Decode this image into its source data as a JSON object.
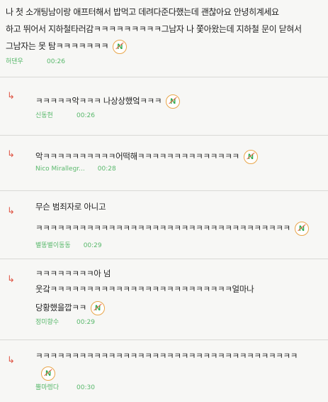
{
  "post": {
    "text_lines": [
      "나 첫 소개팅남이랑 애프터해서 밥먹고 데려다준다했는데 괜찮아요 안녕히계세요",
      "하고 뛰어서 지하철타러감ㅋㅋㅋㅋㅋㅋㅋㅋㅋ그남자 나 쫓아왔는데 지하철 문이 닫혀서",
      "그남자는 못 탐ㅋㅋㅋㅋㅋㅋㅋ"
    ],
    "author": "허댄우",
    "time": "00:26"
  },
  "badge_letter": "N",
  "replies": [
    {
      "lines": [
        "ㅋㅋㅋㅋㅋ악ㅋㅋㅋ 나상상했엌ㅋㅋㅋ"
      ],
      "author": "신동현",
      "time": "00:26"
    },
    {
      "lines": [
        "악ㅋㅋㅋㅋㅋㅋㅋㅋㅋㅋ어떡해ㅋㅋㅋㅋㅋㅋㅋㅋㅋㅋㅋㅋㅋㅋ"
      ],
      "author": "Nico Mirallegr...",
      "time": "00:28"
    },
    {
      "lines": [
        "무슨 범죄자로 아니고",
        "ㅋㅋㅋㅋㅋㅋㅋㅋㅋㅋㅋㅋㅋㅋㅋㅋㅋㅋㅋㅋㅋㅋㅋㅋㅋㅋㅋㅋㅋㅋㅋㅋㅋㅋㅋ"
      ],
      "author": "별똥별이동동",
      "time": "00:29"
    },
    {
      "lines": [
        "ㅋㅋㅋㅋㅋㅋㅋㅋ아 넘",
        "웃갘ㅋㅋㅋㅋㅋㅋㅋㅋㅋㅋㅋㅋㅋㅋㅋㅋㅋㅋㅋㅋㅋㅋㅋㅋㅋ얼마나",
        "당황했을깝ㅋㅋ"
      ],
      "author": "정미향수",
      "time": "00:29"
    },
    {
      "lines": [
        "ㅋㅋㅋㅋㅋㅋㅋㅋㅋㅋㅋㅋㅋㅋㅋㅋㅋㅋㅋㅋㅋㅋㅋㅋㅋㅋㅋㅋㅋㅋㅋㅋㅋㅋㅋㅋ"
      ],
      "author": "뿔마렝다",
      "time": "00:30"
    }
  ],
  "reply_icon": "↳"
}
